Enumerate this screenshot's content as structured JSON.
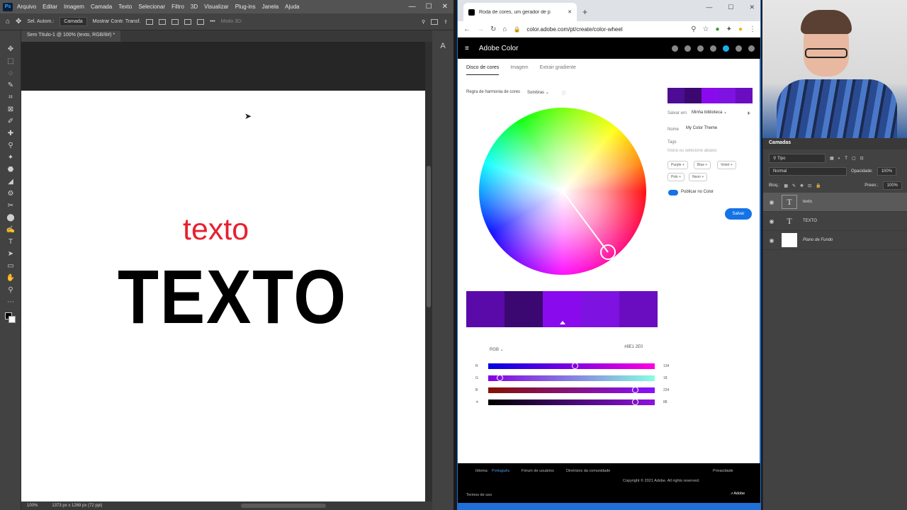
{
  "photoshop": {
    "logo": "Ps",
    "menu": [
      "Arquivo",
      "Editar",
      "Imagem",
      "Camada",
      "Texto",
      "Selecionar",
      "Filtro",
      "3D",
      "Visualizar",
      "Plug-ins",
      "Janela",
      "Ajuda"
    ],
    "window_controls": [
      "—",
      "☐",
      "✕"
    ],
    "options": {
      "auto_select_label": "Sel. Autom.:",
      "auto_select_value": "Camada",
      "show_transform_label": "Mostrar Contr. Transf.",
      "mode_3d_label": "Modo 3D:"
    },
    "document_tab": "Sem Título-1 @ 100% (texto, RGB/8#) *",
    "canvas": {
      "text_red": "texto",
      "text_black": "TEXTO"
    },
    "status": {
      "zoom": "100%",
      "dimensions": "1373 px x 1269 px (72 ppi)"
    },
    "tools": [
      "✥",
      "⬚",
      "◌",
      "✎",
      "⌗",
      "⊠",
      "✐",
      "✚",
      "⚲",
      "✦",
      "⬣",
      "◢",
      "⚙",
      "✂",
      "⬤",
      "✍",
      "T",
      "➤",
      "▭",
      "✋",
      "⚲",
      "⋯"
    ]
  },
  "browser": {
    "tab_title": "Roda de cores, um gerador de p",
    "new_tab": "+",
    "window_controls": [
      "—",
      "☐",
      "✕"
    ],
    "url": "color.adobe.com/pt/create/color-wheel",
    "nav": [
      "←",
      "→",
      "↻",
      "⌂"
    ]
  },
  "adobe_color": {
    "brand": "Adobe Color",
    "tabs": [
      "Disco de cores",
      "Imagem",
      "Extrair gradiente"
    ],
    "harmony_label": "Regra de harmonia de cores",
    "harmony_value": "Sombras",
    "swatches": [
      "#5a0aa8",
      "#3a0870",
      "#8a0aee",
      "#7e12e0",
      "#6a0cc0"
    ],
    "theme_colors": [
      "#4c0c94",
      "#3a0870",
      "#8a0aee",
      "#7e12e0",
      "#6a0cc0"
    ],
    "color_mode": "RGB",
    "hex_value": "#8E1 2E0",
    "sliders": [
      {
        "label": "R",
        "value": "134",
        "pos": 0.52,
        "gradient": "linear-gradient(90deg,#0000e0,#ff00e0)"
      },
      {
        "label": "G",
        "value": "18",
        "pos": 0.07,
        "gradient": "linear-gradient(90deg,#8600e0,#86ffe0)"
      },
      {
        "label": "B",
        "value": "224",
        "pos": 0.88,
        "gradient": "linear-gradient(90deg,#861200,#8612ff)"
      },
      {
        "label": "☀",
        "value": "88",
        "pos": 0.88,
        "gradient": "linear-gradient(90deg,#000000,#8e12e0)"
      }
    ],
    "side": {
      "save_to_label": "Salvar em",
      "library": "Minha biblioteca",
      "name_label": "Nome",
      "name_value": "My Color Theme",
      "tags_label": "Tags",
      "tags_placeholder": "Insira ou selecione abaixo",
      "tags": [
        "Purple +",
        "Blue +",
        "Violet +",
        "Pink +",
        "Neon +"
      ],
      "publish_label": "Publicar no Color",
      "save_button": "Salvar"
    },
    "footer": {
      "language_label": "Idioma:",
      "language": "Português",
      "forum": "Fórum de usuários",
      "guidelines": "Diretrizes da comunidade",
      "privacy": "Privacidade",
      "copyright": "Copyright © 2021 Adobe. All rights reserved.",
      "terms": "Termos de uso",
      "adobe": "Adobe"
    }
  },
  "layers_panel": {
    "title": "Camadas",
    "filter": "Tipo",
    "blend_mode": "Normal",
    "opacity_label": "Opacidade:",
    "opacity": "100%",
    "lock_label": "Bloq.:",
    "fill_label": "Preen.:",
    "fill": "100%",
    "layers": [
      {
        "name": "texto",
        "thumb": "T",
        "selected": true
      },
      {
        "name": "TEXTO",
        "thumb": "T",
        "selected": false
      },
      {
        "name": "Plano de Fundo",
        "thumb": "",
        "selected": false
      }
    ]
  }
}
